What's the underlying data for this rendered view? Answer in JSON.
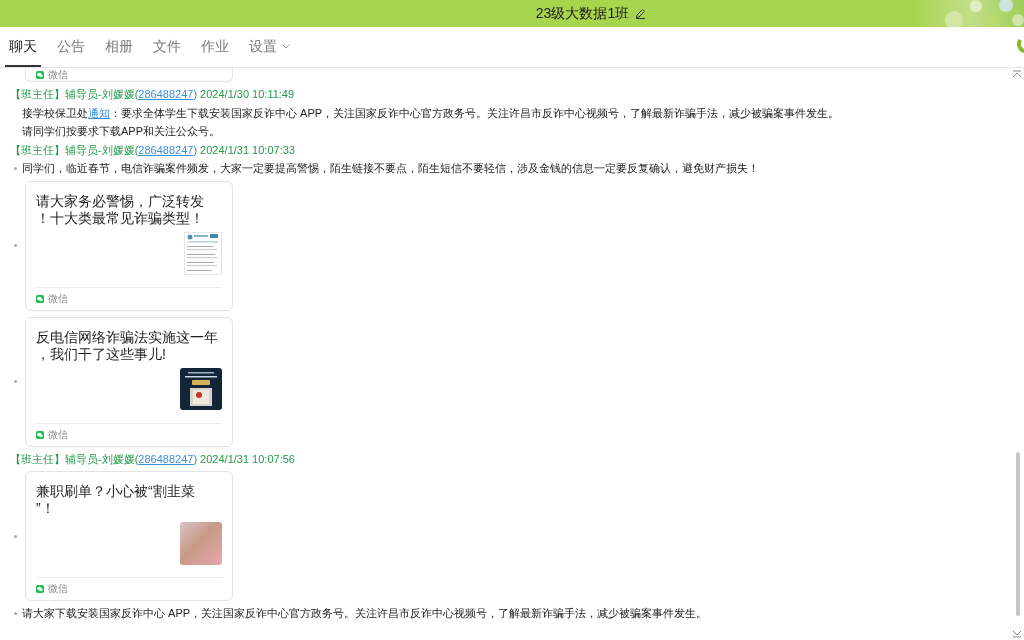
{
  "window": {
    "title": "23级大数据1班"
  },
  "tabs": [
    {
      "label": "聊天",
      "selected": true,
      "dropdown": false
    },
    {
      "label": "公告",
      "selected": false,
      "dropdown": false
    },
    {
      "label": "相册",
      "selected": false,
      "dropdown": false
    },
    {
      "label": "文件",
      "selected": false,
      "dropdown": false
    },
    {
      "label": "作业",
      "selected": false,
      "dropdown": false
    },
    {
      "label": "设置",
      "selected": false,
      "dropdown": true
    }
  ],
  "chat": {
    "clipped_card": {
      "source": "微信"
    },
    "messages": [
      {
        "header": [
          {
            "kind": "plain",
            "text": "【班主任】辅导员-刘媛媛("
          },
          {
            "kind": "link",
            "text": "286488247"
          },
          {
            "kind": "plain",
            "text": ") 2024/1/30 10:11:49"
          }
        ],
        "items": [
          {
            "kind": "text",
            "bullet": false,
            "parts": [
              {
                "kind": "plain",
                "text": "接学校保卫处"
              },
              {
                "kind": "link",
                "text": "通知"
              },
              {
                "kind": "plain",
                "text": "：要求全体学生下载安装国家反诈中心 APP，关注国家反诈中心官方政务号。关注许昌市反诈中心视频号，了解最新诈骗手法，减少被骗案事件发生。"
              }
            ]
          },
          {
            "kind": "text",
            "bullet": false,
            "parts": [
              {
                "kind": "plain",
                "text": "请同学们按要求下载APP和关注公众号。"
              }
            ]
          }
        ]
      },
      {
        "header": [
          {
            "kind": "plain",
            "text": "【班主任】辅导员-刘媛媛("
          },
          {
            "kind": "link",
            "text": "286488247"
          },
          {
            "kind": "plain",
            "text": ") 2024/1/31 10:07:33"
          }
        ],
        "items": [
          {
            "kind": "text",
            "bullet": true,
            "parts": [
              {
                "kind": "plain",
                "text": "同学们，临近春节，电信诈骗案件频发，大家一定要提高警惕，陌生链接不要点，陌生短信不要轻信，涉及金钱的信息一定要反复确认，避免财产损失！"
              }
            ]
          },
          {
            "kind": "card",
            "bullet": true,
            "title_lines": [
              "请大家务必警惕，广泛转发",
              "！十大类最常见诈骗类型！"
            ],
            "thumbnail": {
              "kind": "document"
            },
            "source": "微信"
          },
          {
            "kind": "card",
            "bullet": true,
            "title_lines": [
              "反电信网络诈骗法实施这一年",
              "，我们干了这些事儿!"
            ],
            "thumbnail": {
              "kind": "poster"
            },
            "source": "微信"
          }
        ]
      },
      {
        "header": [
          {
            "kind": "plain",
            "text": "【班主任】辅导员-刘媛媛("
          },
          {
            "kind": "link",
            "text": "286488247"
          },
          {
            "kind": "plain",
            "text": ") 2024/1/31 10:07:56"
          }
        ],
        "items": [
          {
            "kind": "card",
            "bullet": true,
            "title_lines": [
              "兼职刷单？小心被“割韭菜",
              "”！"
            ],
            "thumbnail": {
              "kind": "photo"
            },
            "source": "微信"
          },
          {
            "kind": "text",
            "bullet": true,
            "parts": [
              {
                "kind": "plain",
                "text": "请大家下载安装国家反诈中心 APP，关注国家反诈中心官方政务号。关注许昌市反诈中心视频号，了解最新诈骗手法，减少被骗案事件发生。"
              }
            ]
          }
        ]
      }
    ]
  }
}
